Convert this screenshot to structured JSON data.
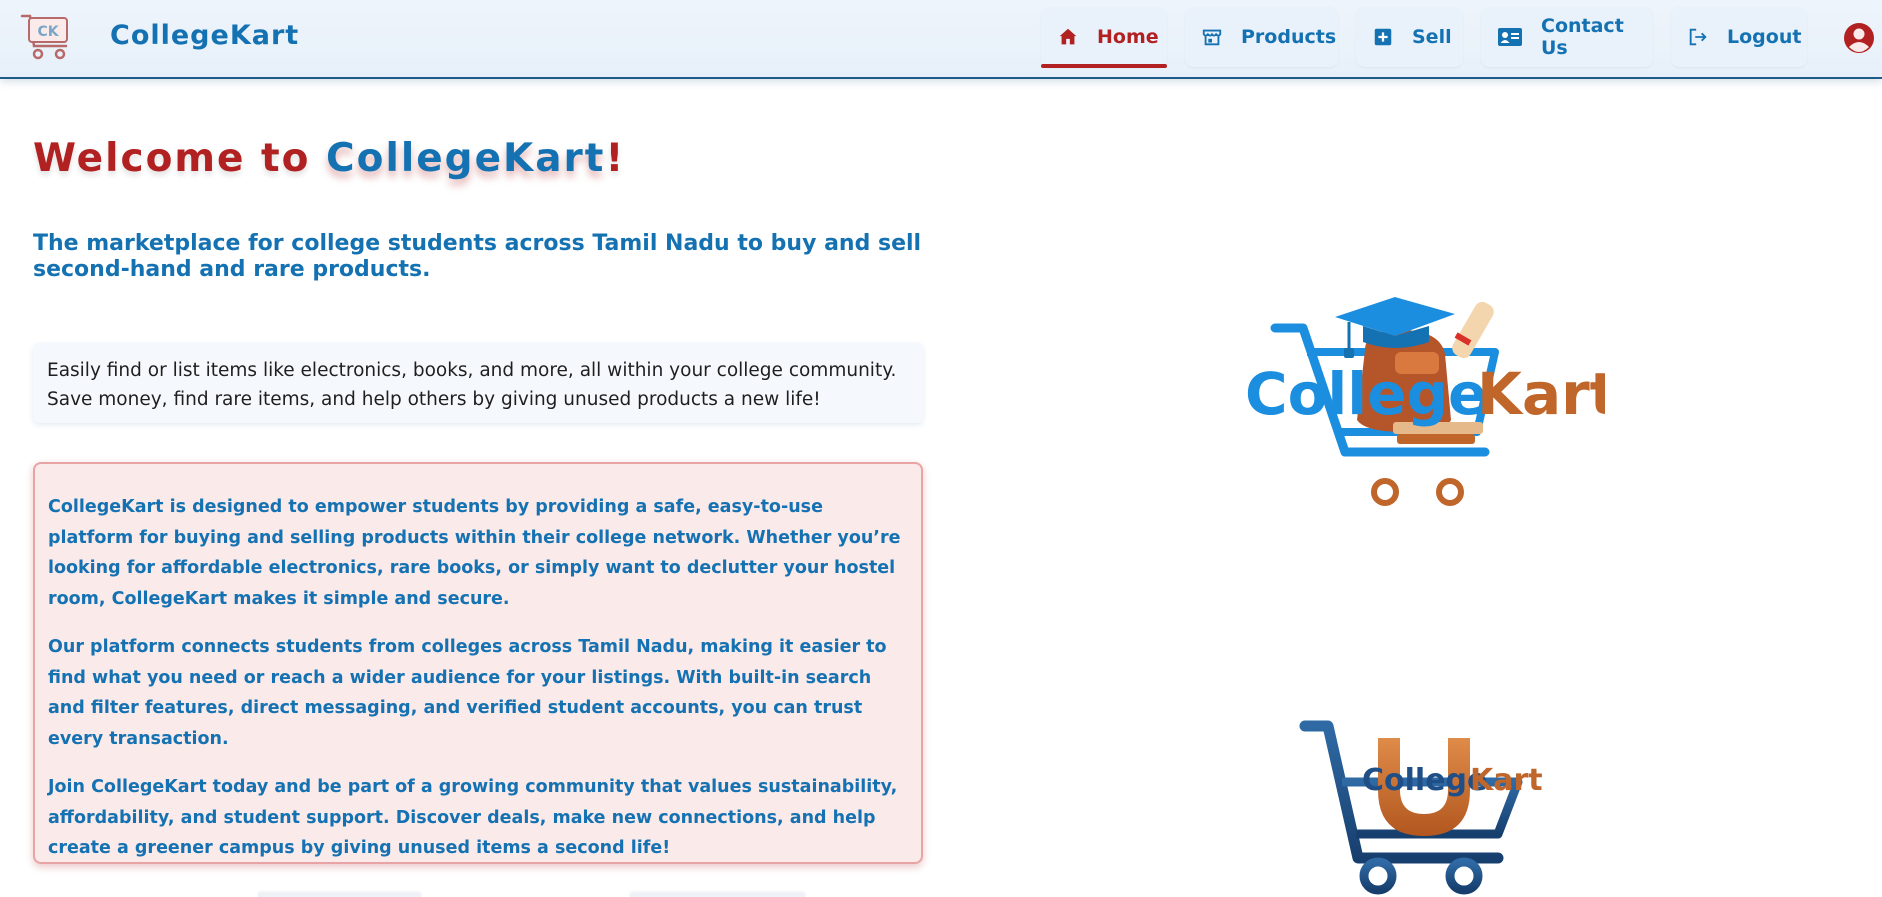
{
  "brand": {
    "name": "CollegeKart",
    "logo_text": "CK"
  },
  "nav": {
    "items": [
      {
        "label": "Home",
        "icon": "home-icon",
        "active": true
      },
      {
        "label": "Products",
        "icon": "store-icon",
        "active": false
      },
      {
        "label": "Sell",
        "icon": "plus-square-icon",
        "active": false
      },
      {
        "label": "Contact Us",
        "icon": "contact-card-icon",
        "active": false
      },
      {
        "label": "Logout",
        "icon": "logout-icon",
        "active": false
      }
    ],
    "account_icon": "account-circle-icon"
  },
  "hero": {
    "welcome_prefix": "Welcome to ",
    "welcome_brand": "CollegeKart",
    "welcome_suffix": "!",
    "subtitle": "The marketplace for college students across Tamil Nadu to buy and sell second-hand and rare products.",
    "intro": "Easily find or list items like electronics, books, and more, all within your college community. Save money, find rare items, and help others by giving unused products a new life!"
  },
  "about": {
    "paragraphs": [
      "CollegeKart is designed to empower students by providing a safe, easy-to-use platform for buying and selling products within their college network. Whether you’re looking for affordable electronics, rare books, or simply want to declutter your hostel room, CollegeKart makes it simple and secure.",
      "Our platform connects students from colleges across Tamil Nadu, making it easier to find what you need or reach a wider audience for your listings. With built-in search and filter features, direct messaging, and verified student accounts, you can trust every transaction.",
      "Join CollegeKart today and be part of a growing community that values sustainability, affordability, and student support. Discover deals, make new connections, and help create a greener campus by giving unused items a second life!"
    ]
  },
  "images": {
    "logo_main": {
      "part1": "College",
      "part2": "Kart"
    },
    "logo_cart": {
      "part1": "College",
      "part2": "Kart"
    }
  },
  "colors": {
    "brand_blue": "#1572b2",
    "brand_red": "#b12121",
    "brand_orange": "#c0662a",
    "header_bg": "#e7f0fa",
    "about_bg": "#fbeaea"
  }
}
